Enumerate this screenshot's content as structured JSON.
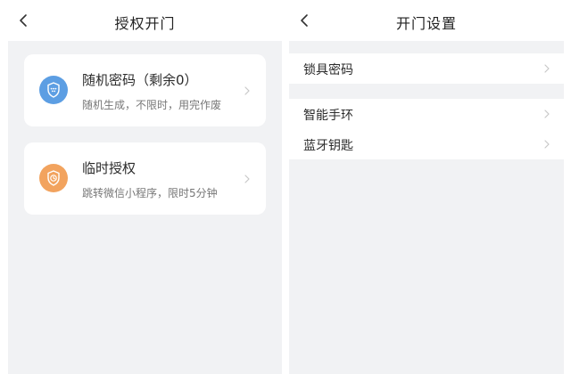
{
  "left_screen": {
    "title": "授权开门",
    "cards": [
      {
        "title": "随机密码（剩余0）",
        "subtitle": "随机生成，不限时，用完作废",
        "icon": "shield-keypad-icon",
        "icon_color": "#5c9ee3"
      },
      {
        "title": "临时授权",
        "subtitle": "跳转微信小程序，限时5分钟",
        "icon": "shield-clock-icon",
        "icon_color": "#f2a35e"
      }
    ]
  },
  "right_screen": {
    "title": "开门设置",
    "groups": [
      {
        "items": [
          {
            "label": "锁具密码"
          }
        ]
      },
      {
        "items": [
          {
            "label": "智能手环"
          },
          {
            "label": "蓝牙钥匙"
          }
        ]
      }
    ]
  },
  "colors": {
    "page_bg": "#f1f2f4",
    "card_bg": "#ffffff",
    "chevron": "#c8c8c8"
  }
}
